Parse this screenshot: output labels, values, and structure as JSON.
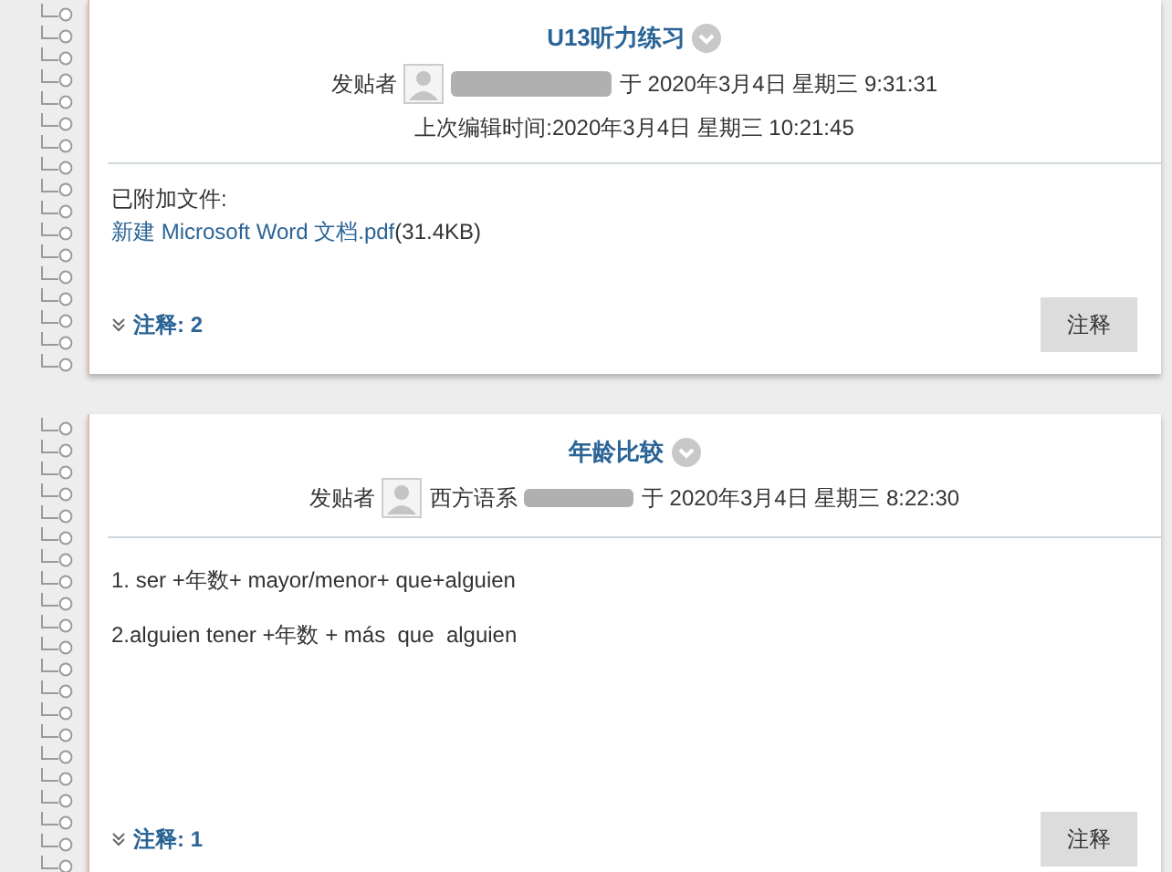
{
  "posts": [
    {
      "title": "U13听力练习",
      "posted_by_label": "发贴者",
      "posted_at": "于 2020年3月4日 星期三 9:31:31",
      "edited": "上次编辑时间:2020年3月4日 星期三 10:21:45",
      "body": [
        {
          "kind": "label",
          "text": "已附加文件:"
        },
        {
          "kind": "attachment",
          "link": "新建 Microsoft Word 文档.pdf",
          "size": "(31.4KB)"
        }
      ],
      "comments_toggle": "注释: 2",
      "comment_button": "注释"
    },
    {
      "title": "年龄比较",
      "posted_by_label": "发贴者",
      "author": "西方语系",
      "posted_at": "于 2020年3月4日 星期三 8:22:30",
      "body": [
        {
          "kind": "paragraph",
          "text": "1. ser +年数+ mayor/menor+ que+alguien"
        },
        {
          "kind": "paragraph",
          "text": "2.alguien tener +年数 + más  que  alguien"
        }
      ],
      "comments_toggle": "注释: 1",
      "comment_button": "注释"
    }
  ]
}
